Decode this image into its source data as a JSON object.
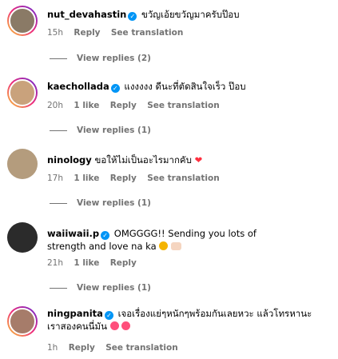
{
  "comments": [
    {
      "username": "nut_devahastin",
      "text": "ขวัญเอ้ยขวัญมาครับป๊อบ",
      "time": "15h",
      "likes": "",
      "reply": "Reply",
      "translate": "See translation",
      "view_replies": "View replies (2)",
      "avatar_color": "#8a7a66"
    },
    {
      "username": "kaechollada",
      "text": "แงงงงง ดีนะที่ตัดสินใจเร็ว ป๊อบ",
      "time": "20h",
      "likes": "1 like",
      "reply": "Reply",
      "translate": "See translation",
      "view_replies": "View replies (1)",
      "avatar_color": "#c9a27c"
    },
    {
      "username": "ninology",
      "text": "ขอให้ไม่เป็นอะไรมากคับ",
      "time": "17h",
      "likes": "1 like",
      "reply": "Reply",
      "translate": "See translation",
      "view_replies": "View replies (1)",
      "avatar_color": "#b49c7d"
    },
    {
      "username": "waiiwaii.p",
      "text": "OMGGGG!! Sending you lots of strength and love na ka",
      "time": "21h",
      "likes": "1 like",
      "reply": "Reply",
      "translate": "",
      "view_replies": "View replies (1)",
      "avatar_color": "#2b2b2b"
    },
    {
      "username": "ningpanita",
      "text": "เจอเรื่องแย่ๆหนักๆพร้อมกันเลยหวะ แล้วโทรหานะ เราสองคนนี่มัน",
      "time": "1h",
      "likes": "",
      "reply": "Reply",
      "translate": "See translation",
      "view_replies": "",
      "avatar_color": "#a67c6a"
    }
  ],
  "colors": {
    "verified": "#0095f6",
    "meta_text": "#737373",
    "heart": "#ff3040"
  }
}
